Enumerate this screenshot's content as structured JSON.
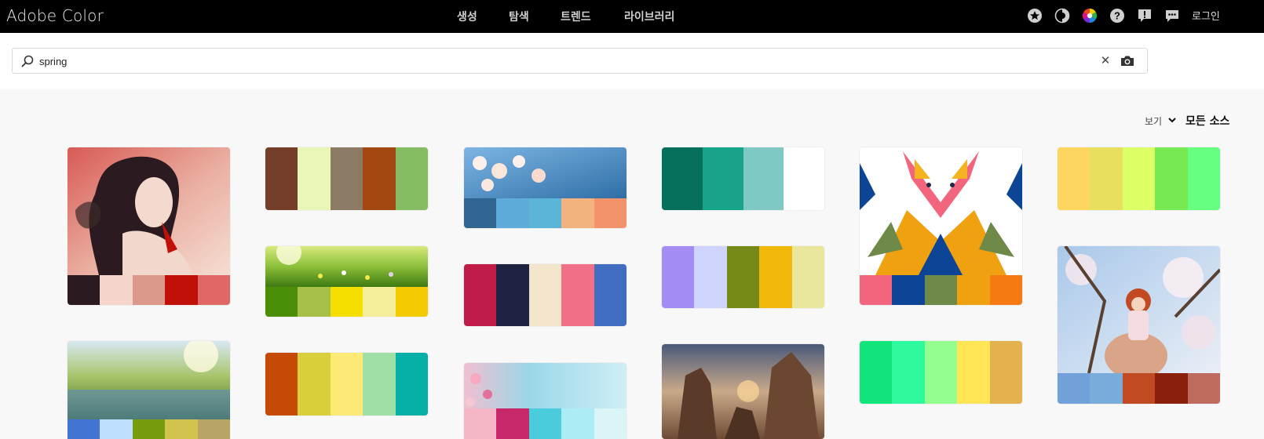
{
  "header": {
    "brand": "Adobe Color",
    "nav": [
      {
        "label": "생성"
      },
      {
        "label": "탐색"
      },
      {
        "label": "트렌드"
      },
      {
        "label": "라이브러리"
      }
    ],
    "icons": [
      "star-icon",
      "contrast-icon",
      "color-wheel-icon",
      "help-icon",
      "feedback-icon",
      "chat-icon"
    ],
    "login": "로그인"
  },
  "search": {
    "value": "spring",
    "placeholder": ""
  },
  "toolbar": {
    "view_label": "보기",
    "source_label": "모든 소스"
  },
  "palettes": [
    {
      "id": "c1",
      "image": "illustration-woman",
      "colors": [
        "#2b1a1f",
        "#f4d4cb",
        "#dc998b",
        "#c10f0a",
        "#df6766"
      ]
    },
    {
      "id": "c2",
      "image": null,
      "colors": [
        "#743e2a",
        "#e8f6b8",
        "#8b7a64",
        "#a34713",
        "#84bd62"
      ]
    },
    {
      "id": "c3",
      "image": "cherry-blossom-sky",
      "colors": [
        "#306592",
        "#5eabd9",
        "#5bb5d7",
        "#f3b37f",
        "#f3936c"
      ]
    },
    {
      "id": "c4",
      "image": null,
      "colors": [
        "#07705d",
        "#18a48a",
        "#7ec9c3",
        "#ffffff"
      ]
    },
    {
      "id": "c5",
      "image": "fox-illustration",
      "colors": [
        "#f2657d",
        "#0d4596",
        "#6f8a48",
        "#f0a10f",
        "#f57a11"
      ]
    },
    {
      "id": "c6",
      "image": null,
      "colors": [
        "#fdd661",
        "#e8df5e",
        "#ddff66",
        "#77e953",
        "#66ff7f"
      ]
    },
    {
      "id": "c7",
      "image": "meadow-flowers",
      "colors": [
        "#4a8f07",
        "#a6c049",
        "#f4df00",
        "#f4ee9c",
        "#f4cb00"
      ]
    },
    {
      "id": "c8",
      "image": null,
      "colors": [
        "#c11c47",
        "#1f2342",
        "#f3e5cc",
        "#f27087",
        "#416dc1"
      ]
    },
    {
      "id": "c9",
      "image": null,
      "colors": [
        "#a38cf4",
        "#cfd4ff",
        "#768a1a",
        "#f1b909",
        "#e9e79e"
      ]
    },
    {
      "id": "c10",
      "image": "doll-cherry-tree",
      "colors": [
        "#72a1d9",
        "#79acd9",
        "#c24a22",
        "#8a1f0b",
        "#bd6c5f"
      ]
    },
    {
      "id": "c11",
      "image": "spring-field",
      "colors": [
        "#4174d3",
        "#bfdfff",
        "#779b0f",
        "#d2c34f",
        "#b8a565"
      ]
    },
    {
      "id": "c12",
      "image": null,
      "colors": [
        "#c44a06",
        "#d9cf3c",
        "#fde976",
        "#9fe0a6",
        "#06b0a6"
      ]
    },
    {
      "id": "c13",
      "image": "cherry-branch",
      "colors": [
        "#f5b6c6",
        "#c6286a",
        "#4accdc",
        "#acecf4",
        "#dbf4f6"
      ]
    },
    {
      "id": "c14",
      "image": "rock-sunset",
      "colors": []
    },
    {
      "id": "c15",
      "image": null,
      "colors": [
        "#10e47a",
        "#2ff99d",
        "#92ff8f",
        "#ffe454",
        "#e5b04e"
      ]
    }
  ]
}
